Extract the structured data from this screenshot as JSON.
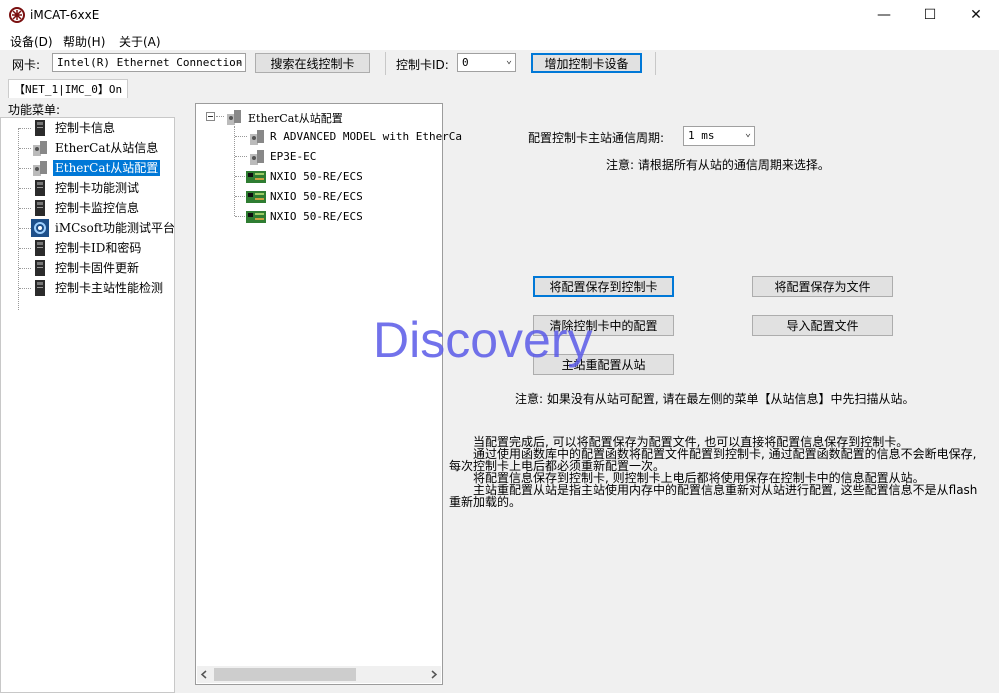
{
  "window": {
    "title": "iMCAT-6xxE",
    "minimize_glyph": "—",
    "maximize_glyph": "☐",
    "close_glyph": "✕"
  },
  "menubar": {
    "items": [
      "设备(D)",
      "帮助(H)",
      "关于(A)"
    ]
  },
  "toolbar": {
    "nic_label": "网卡:",
    "nic_value": "Intel(R) Ethernet Connection",
    "search_button": "搜索在线控制卡",
    "card_id_label": "控制卡ID:",
    "card_id_value": "0",
    "add_device_button": "增加控制卡设备"
  },
  "tabs": [
    "【NET_1|IMC_0】On"
  ],
  "left_menu": {
    "header": "功能菜单:",
    "items": [
      {
        "label": "控制卡信息",
        "icon": "card-icon",
        "selected": false
      },
      {
        "label": "EtherCat从站信息",
        "icon": "slave-icon",
        "selected": false
      },
      {
        "label": "EtherCat从站配置",
        "icon": "slave-icon",
        "selected": true
      },
      {
        "label": "控制卡功能测试",
        "icon": "card-icon",
        "selected": false
      },
      {
        "label": "控制卡监控信息",
        "icon": "card-icon",
        "selected": false
      },
      {
        "label": "iMCsoft功能测试平台",
        "icon": "gear-app-icon",
        "selected": false
      },
      {
        "label": "控制卡ID和密码",
        "icon": "card-icon",
        "selected": false
      },
      {
        "label": "控制卡固件更新",
        "icon": "card-icon",
        "selected": false
      },
      {
        "label": "控制卡主站性能检测",
        "icon": "card-icon",
        "selected": false
      }
    ]
  },
  "slave_tree": {
    "root": "EtherCat从站配置",
    "children": [
      {
        "label": "R ADVANCED MODEL with EtherCa",
        "icon": "servo-icon"
      },
      {
        "label": "EP3E-EC",
        "icon": "servo-icon"
      },
      {
        "label": "NXIO 50-RE/ECS",
        "icon": "io-board-icon"
      },
      {
        "label": "NXIO 50-RE/ECS",
        "icon": "io-board-icon"
      },
      {
        "label": "NXIO 50-RE/ECS",
        "icon": "io-board-icon"
      }
    ]
  },
  "config": {
    "period_label": "配置控制卡主站通信周期:",
    "period_value": "1 ms",
    "period_note": "注意: 请根据所有从站的通信周期来选择。",
    "save_to_card": "将配置保存到控制卡",
    "save_to_file": "将配置保存为文件",
    "clear_card": "清除控制卡中的配置",
    "import_file": "导入配置文件",
    "reconfigure": "主站重配置从站",
    "scan_note": "注意: 如果没有从站可配置, 请在最左侧的菜单【从站信息】中先扫描从站。",
    "help_lines": [
      "　　当配置完成后, 可以将配置保存为配置文件, 也可以直接将配置信息保存到控制卡。",
      "　　通过使用函数库中的配置函数将配置文件配置到控制卡, 通过配置函数配置的信息不会断电保存,",
      "每次控制卡上电后都必须重新配置一次。",
      "　　将配置信息保存到控制卡, 则控制卡上电后都将使用保存在控制卡中的信息配置从站。",
      "　　主站重配置从站是指主站使用内存中的配置信息重新对从站进行配置, 这些配置信息不是从flash",
      "重新加载的。"
    ]
  },
  "watermark": "Discovery"
}
